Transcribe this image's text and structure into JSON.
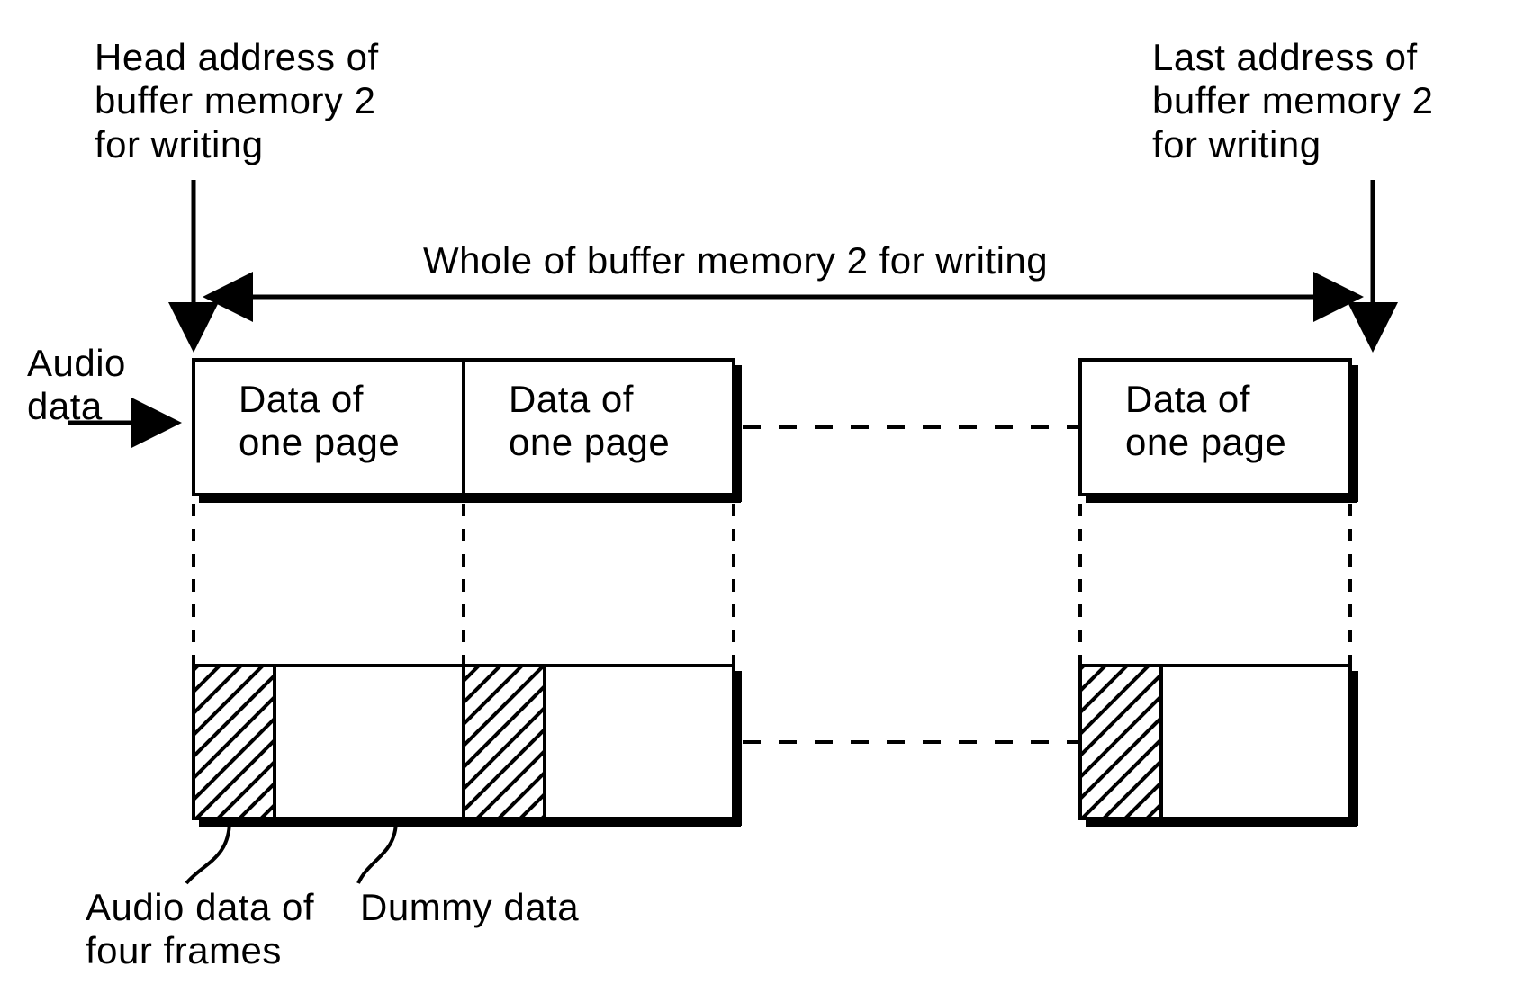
{
  "labels": {
    "head_address": "Head address of\nbuffer memory 2\nfor writing",
    "last_address": "Last address of\nbuffer memory 2\nfor writing",
    "whole_buffer": "Whole of buffer memory 2 for writing",
    "audio_data": "Audio\ndata",
    "page1": "Data of\none page",
    "page2": "Data of\none page",
    "page3": "Data of\none page",
    "audio_four_frames": "Audio data of\nfour frames",
    "dummy_data": "Dummy data"
  },
  "chart_data": {
    "type": "diagram",
    "title": "Buffer memory 2 for writing — page structure",
    "total_pages_shown": 3,
    "ellipsis_implies_more_pages": true,
    "annotations": {
      "left_boundary": "Head address of buffer memory 2 for writing",
      "right_boundary": "Last address of buffer memory 2 for writing",
      "span_label": "Whole of buffer memory 2 for writing",
      "input_arrow": "Audio data"
    },
    "page_detail": {
      "segments": [
        {
          "name": "Audio data of four frames",
          "pattern": "hatched"
        },
        {
          "name": "Dummy data",
          "pattern": "blank"
        }
      ]
    }
  }
}
